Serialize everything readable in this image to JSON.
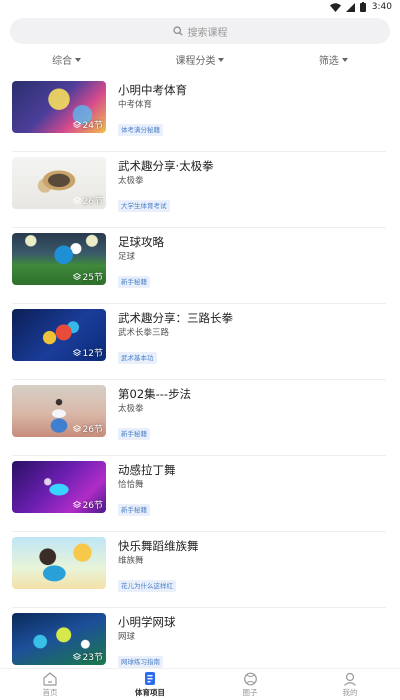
{
  "status_bar": {
    "time": "3:40"
  },
  "search": {
    "placeholder": "搜索课程"
  },
  "filters": [
    {
      "label": "综合"
    },
    {
      "label": "课程分类"
    },
    {
      "label": "筛选"
    }
  ],
  "courses": [
    {
      "title": "小明中考体育",
      "subtitle": "中考体育",
      "tag": "体考满分秘籍",
      "lessons": "24节"
    },
    {
      "title": "武术趣分享·太极拳",
      "subtitle": "太极拳",
      "tag": "大学生体育考试",
      "lessons": "26节"
    },
    {
      "title": "足球攻略",
      "subtitle": "足球",
      "tag": "新手秘籍",
      "lessons": "25节"
    },
    {
      "title": "武术趣分享：三路长拳",
      "subtitle": "武术长拳三路",
      "tag": "武术基本功",
      "lessons": "12节"
    },
    {
      "title": "第02集---步法",
      "subtitle": "太极拳",
      "tag": "新手秘籍",
      "lessons": "26节"
    },
    {
      "title": "动感拉丁舞",
      "subtitle": "恰恰舞",
      "tag": "新手秘籍",
      "lessons": "26节"
    },
    {
      "title": "快乐舞蹈维族舞",
      "subtitle": "维族舞",
      "tag": "花儿为什么这样红",
      "lessons": ""
    },
    {
      "title": "小明学网球",
      "subtitle": "网球",
      "tag": "网球练习指南",
      "lessons": "23节"
    }
  ],
  "bottom_nav": [
    {
      "label": "首页",
      "icon": "home-icon"
    },
    {
      "label": "体育项目",
      "icon": "sports-icon"
    },
    {
      "label": "圈子",
      "icon": "circle-icon"
    },
    {
      "label": "我的",
      "icon": "profile-icon"
    }
  ],
  "colors": {
    "tag_text": "#4a7fc9",
    "tag_bg": "#e9f0fb",
    "search_bg": "#f1f1f3"
  }
}
